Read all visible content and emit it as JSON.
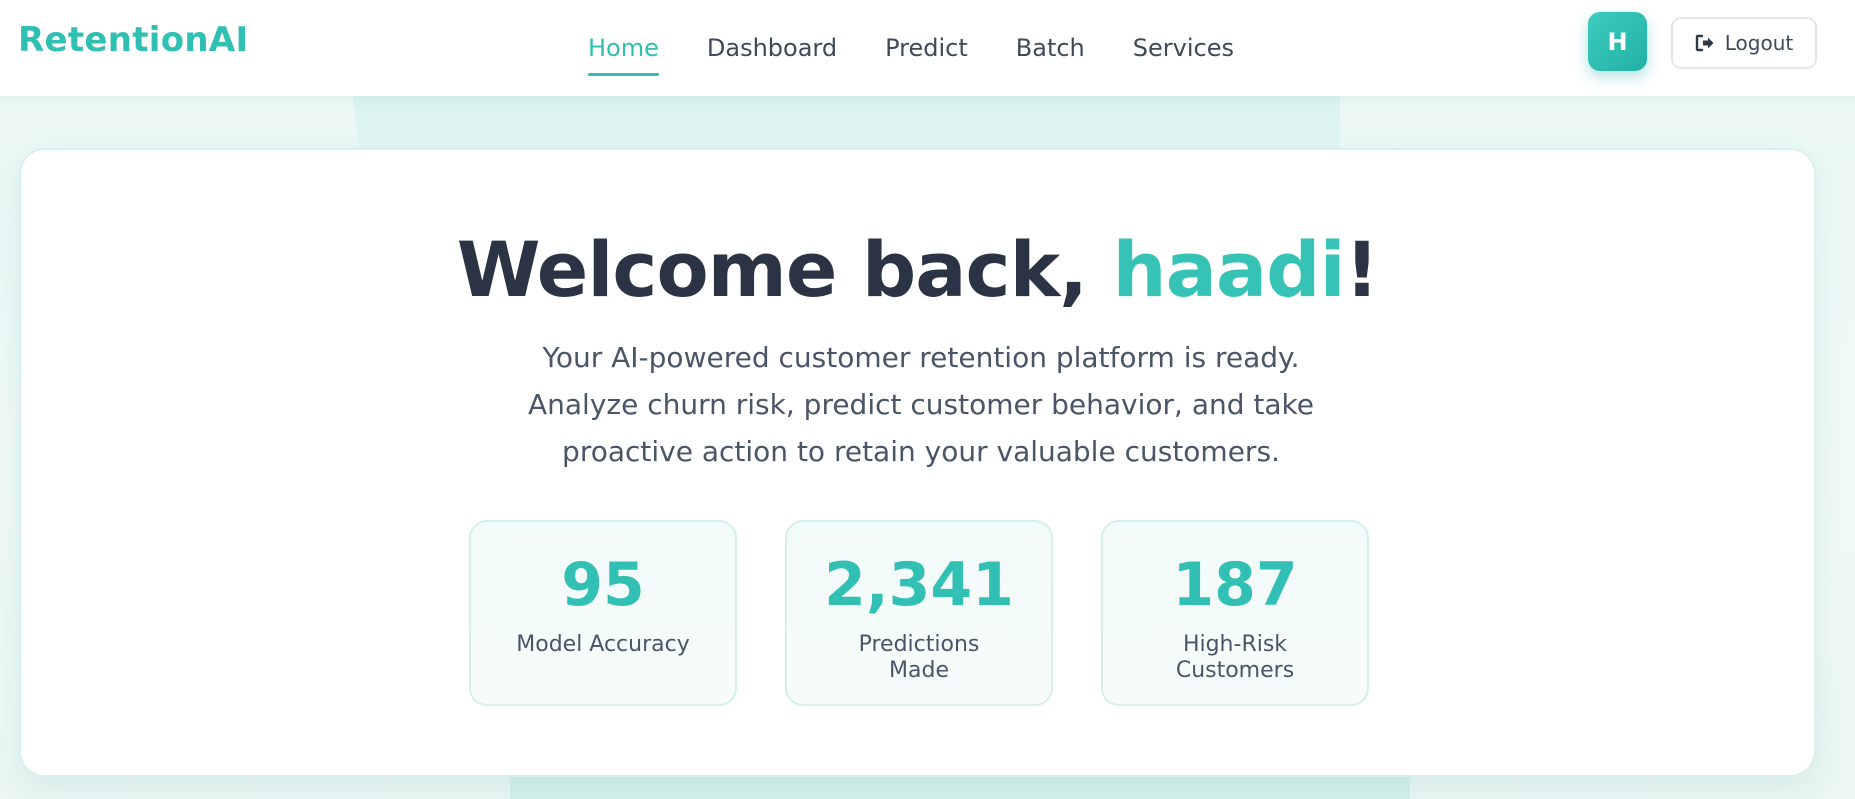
{
  "brand": "RetentionAI",
  "nav": {
    "items": [
      {
        "label": "Home",
        "active": true
      },
      {
        "label": "Dashboard",
        "active": false
      },
      {
        "label": "Predict",
        "active": false
      },
      {
        "label": "Batch",
        "active": false
      },
      {
        "label": "Services",
        "active": false
      }
    ]
  },
  "user": {
    "avatar_initial": "H"
  },
  "logout": {
    "label": "Logout",
    "icon": "logout-icon"
  },
  "welcome": {
    "prefix": "Welcome back, ",
    "name": "haadi",
    "suffix": "!",
    "subtitle": "Your AI-powered customer retention platform is ready. Analyze churn risk, predict customer behavior, and take proactive action to retain your valuable customers."
  },
  "stats": [
    {
      "value": "95",
      "label": "Model Accuracy"
    },
    {
      "value": "2,341",
      "label": "Predictions Made"
    },
    {
      "value": "187",
      "label": "High-Risk Customers"
    }
  ],
  "colors": {
    "accent": "#2fbfb3",
    "text_dark": "#2a3445",
    "text_muted": "#4a5568"
  }
}
